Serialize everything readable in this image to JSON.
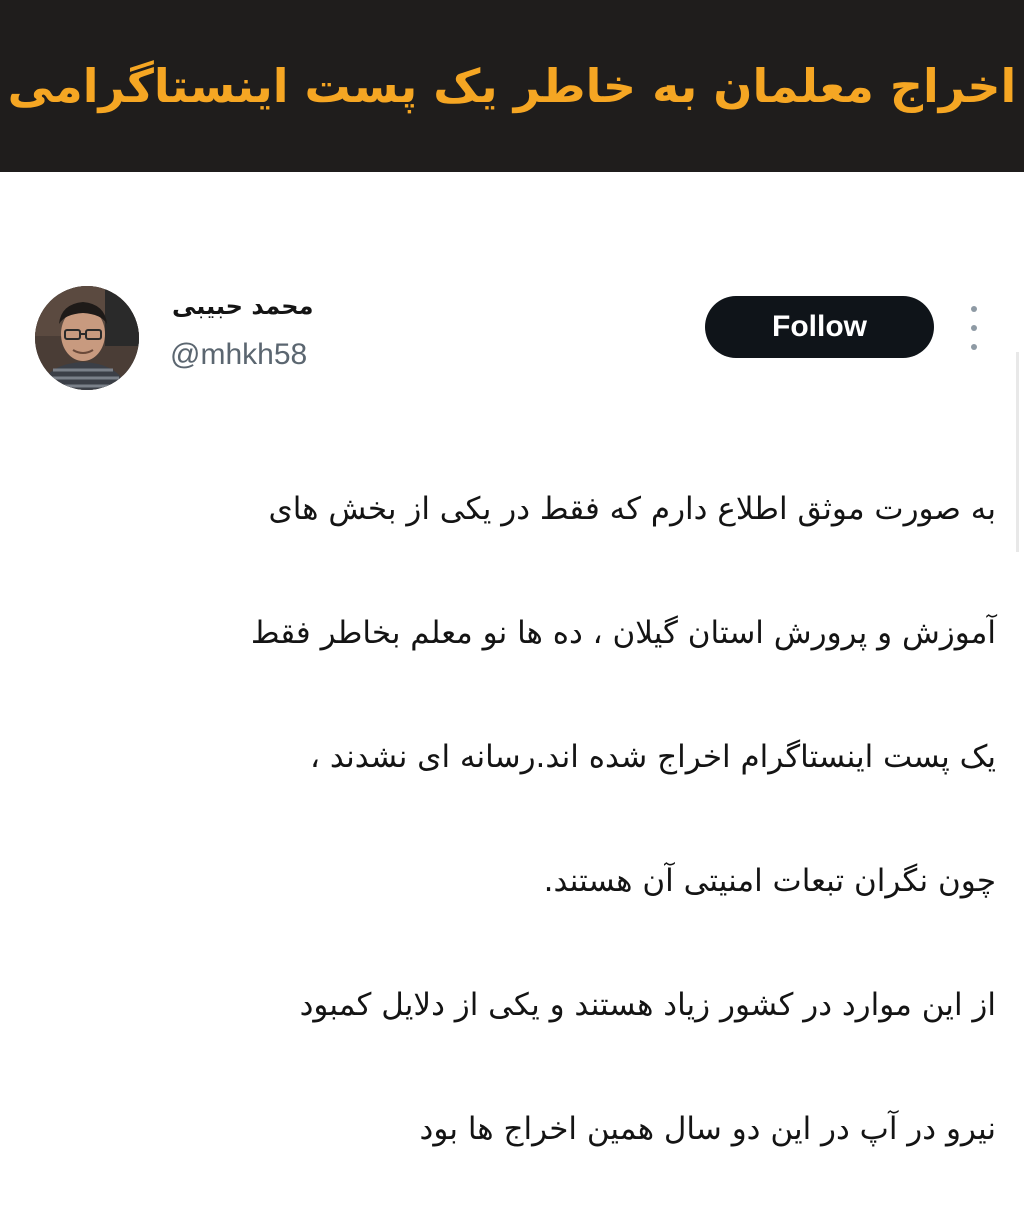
{
  "banner": {
    "title": "اخراج معلمان به خاطر یک پست اینستاگرامی"
  },
  "tweet": {
    "author": {
      "name": "محمد حبیبی",
      "handle": "@mhkh58",
      "avatar_icon": "user-avatar-photo"
    },
    "follow_label": "Follow",
    "more_icon": "more-vertical-icon",
    "lines": [
      "به صورت موثق اطلاع دارم که فقط در یکی از بخش های",
      "آموزش و پرورش استان گیلان ، ده ها نو معلم بخاطر فقط",
      "یک پست اینستاگرام اخراج شده اند.رسانه ای نشدند ،",
      "چون نگران تبعات امنیتی آن هستند.",
      "از این موارد در  کشور زیاد هستند و یکی از دلایل کمبود",
      "نیرو در آپ در این دو سال  همین اخراج ها بود"
    ]
  },
  "colors": {
    "banner_bg": "#1f1d1c",
    "banner_text": "#f5a623",
    "follow_bg": "#0f1419",
    "handle": "#5b6670"
  }
}
